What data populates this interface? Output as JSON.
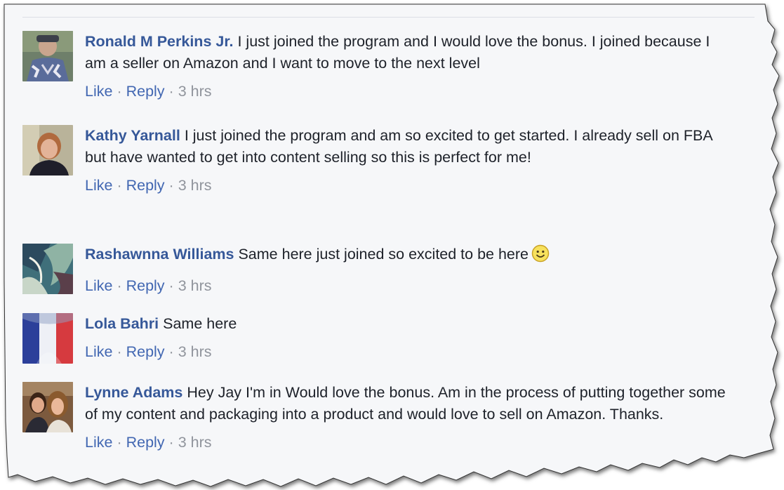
{
  "colors": {
    "panel_background": "#f6f7f9",
    "author_link": "#365899",
    "action_link": "#4267b2",
    "meta_gray": "#90949c",
    "body_text": "#1d2129"
  },
  "comments": [
    {
      "author": "Ronald M Perkins Jr.",
      "text": "I just joined the program and I would love the bonus. I joined because I am a seller on Amazon and I want to move to the next level",
      "like": "Like",
      "reply": "Reply",
      "time": "3 hrs",
      "avatar": "man-with-cap-avatar"
    },
    {
      "author": "Kathy Yarnall",
      "text": "I just joined the program and am so excited to get started. I already sell on FBA but have wanted to get into content selling so this is perfect for me!",
      "like": "Like",
      "reply": "Reply",
      "time": "3 hrs",
      "avatar": "woman-portrait-avatar"
    },
    {
      "author": "Rashawnna Williams",
      "text": "Same here just joined so excited to be here",
      "emoji": "smiley-face-icon",
      "like": "Like",
      "reply": "Reply",
      "time": "3 hrs",
      "avatar": "abstract-painting-avatar"
    },
    {
      "author": "Lola Bahri",
      "text": "Same here",
      "like": "Like",
      "reply": "Reply",
      "time": "3 hrs",
      "avatar": "french-flag-avatar"
    },
    {
      "author": "Lynne Adams",
      "text": "Hey Jay I'm in Would love the bonus. Am in the process of putting together some of my content and packaging into a product and would love to sell on Amazon. Thanks.",
      "like": "Like",
      "reply": "Reply",
      "time": "3 hrs",
      "avatar": "couple-photo-avatar"
    }
  ]
}
